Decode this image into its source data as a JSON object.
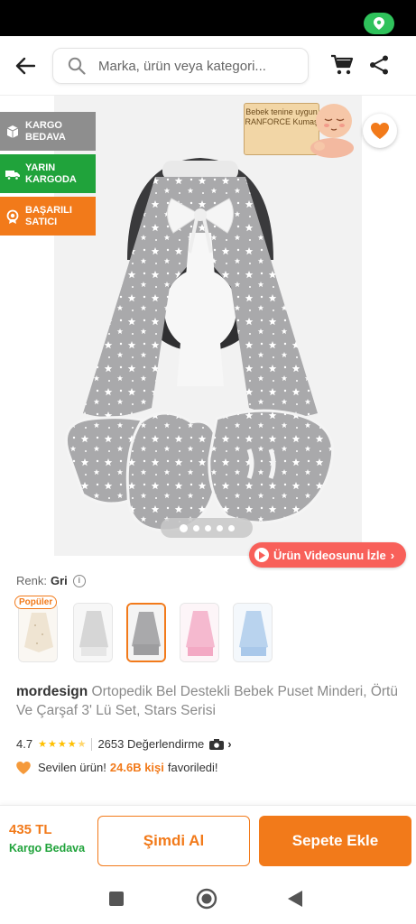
{
  "search": {
    "placeholder": "Marka, ürün veya kategori..."
  },
  "badges": [
    {
      "label": "KARGO BEDAVA",
      "icon": "box-icon"
    },
    {
      "label": "YARIN KARGODA",
      "icon": "truck-icon"
    },
    {
      "label": "BAŞARILI SATICI",
      "icon": "medal-icon"
    }
  ],
  "ranforce": {
    "text": "Bebek tenine uygun RANFORCE Kumaş"
  },
  "gallery": {
    "total_images": 5,
    "active_index": 0
  },
  "video": {
    "label": "Ürün Videosunu İzle"
  },
  "color": {
    "label": "Renk:",
    "value": "Gri"
  },
  "variants": {
    "popular_badge": "Popüler",
    "count": 5,
    "selected_index": 2
  },
  "product": {
    "brand": "mordesign",
    "name": "Ortopedik Bel Destekli Bebek Puset Minderi, Örtü Ve Çarşaf 3' Lü Set, Stars Serisi"
  },
  "rating": {
    "score": "4.7",
    "stars_value": 4.7,
    "review_count": "2653 Değerlendirme"
  },
  "favorite": {
    "prefix": "Sevilen ürün!",
    "highlight": "24.6B kişi",
    "suffix": "favoriledi!"
  },
  "purchase": {
    "price": "435 TL",
    "shipping": "Kargo Bedava",
    "buy_now": "Şimdi Al",
    "add_to_cart": "Sepete Ekle"
  },
  "colors": {
    "accent": "#f27a1a",
    "green": "#20a33b",
    "video": "#f8605a",
    "badge_gray": "#8e8e8e"
  }
}
